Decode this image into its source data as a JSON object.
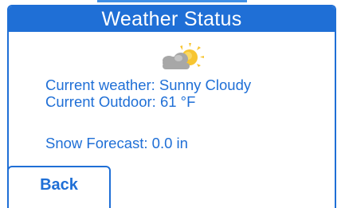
{
  "header": {
    "title": "Weather Status"
  },
  "weather": {
    "icon": "sunny-cloudy-icon",
    "current_weather_text": "Current weather: Sunny Cloudy",
    "current_outdoor_text": "Current Outdoor: 61 °F",
    "snow_forecast_text": "Snow Forecast: 0.0 in"
  },
  "buttons": {
    "back_label": "Back"
  },
  "colors": {
    "accent": "#1f6fd6",
    "sun": "#f7c531",
    "cloud": "#a7a7a7",
    "background": "#ffffff"
  }
}
